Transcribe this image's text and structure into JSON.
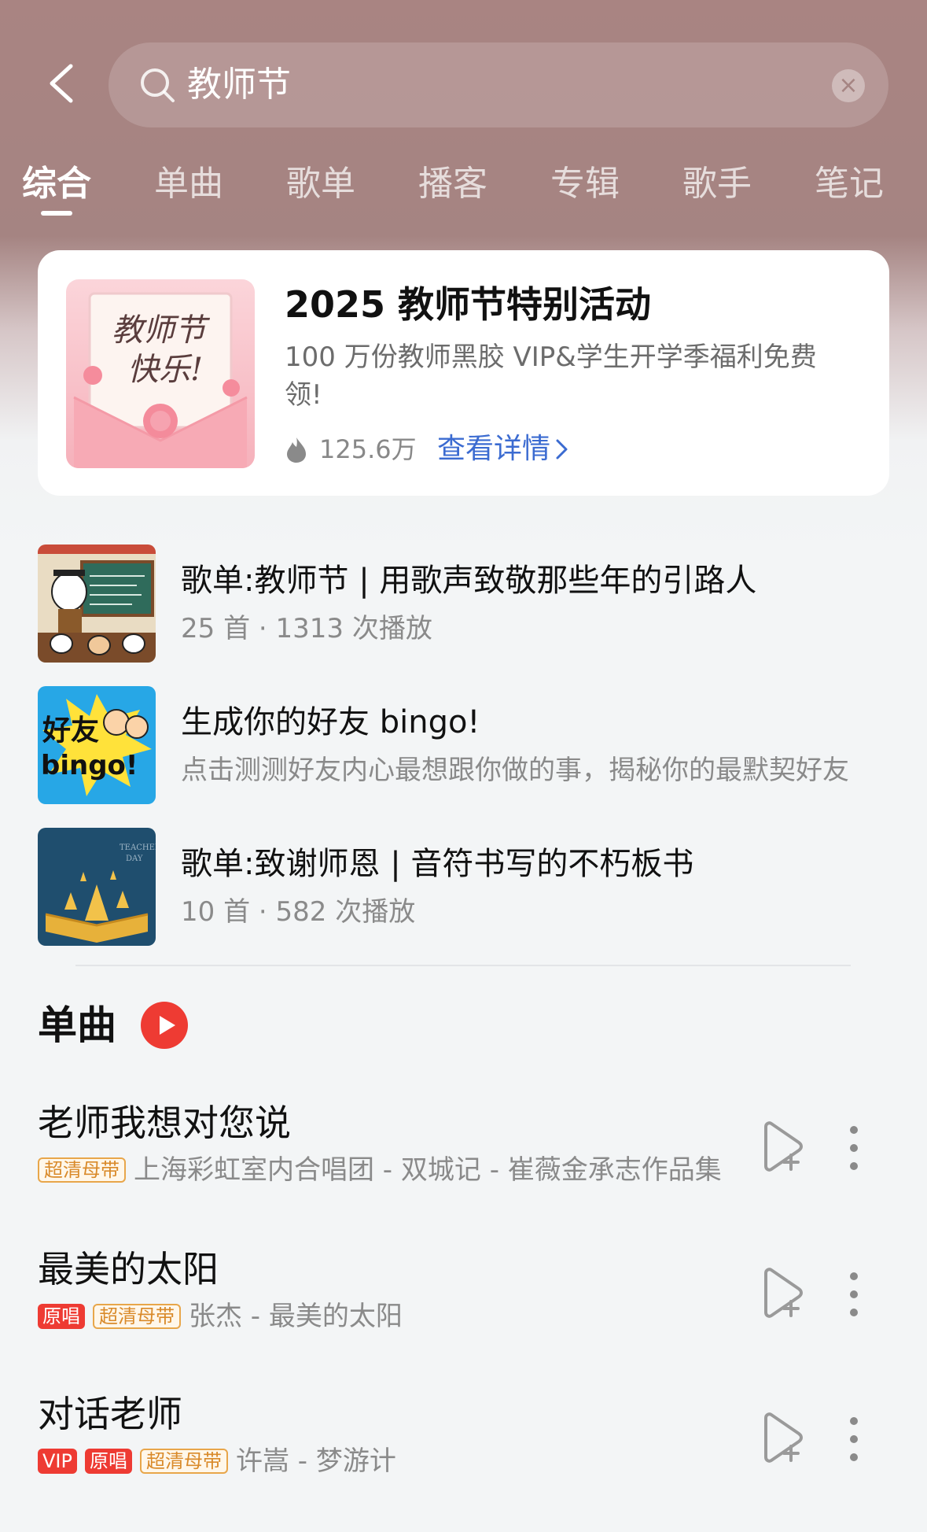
{
  "search": {
    "query": "教师节"
  },
  "tabs": [
    {
      "label": "综合"
    },
    {
      "label": "单曲"
    },
    {
      "label": "歌单"
    },
    {
      "label": "播客"
    },
    {
      "label": "专辑"
    },
    {
      "label": "歌手"
    },
    {
      "label": "笔记"
    }
  ],
  "activity": {
    "title": "2025 教师节特别活动",
    "description": "100 万份教师黑胶 VIP&学生开学季福利免费领!",
    "heat": "125.6万",
    "detail_label": "查看详情",
    "thumb_text_line1": "教师节",
    "thumb_text_line2": "快乐!"
  },
  "playlists": [
    {
      "title": "歌单:教师节 | 用歌声致敬那些年的引路人",
      "subtitle": "25 首 · 1313 次播放"
    },
    {
      "title": "生成你的好友 bingo!",
      "subtitle": "点击测测好友内心最想跟你做的事，揭秘你的最默契好友",
      "cover_text_line1": "好友",
      "cover_text_line2": "bingo!"
    },
    {
      "title": "歌单:致谢师恩 | 音符书写的不朽板书",
      "subtitle": "10 首 · 582 次播放",
      "cover_text_line1": "TEACHERS",
      "cover_text_line2": "DAY"
    }
  ],
  "songs_section": {
    "title": "单曲"
  },
  "songs": [
    {
      "title": "老师我想对您说",
      "badges": [
        "超清母带"
      ],
      "artist": "上海彩虹室内合唱团 - 双城记 - 崔薇金承志作品集"
    },
    {
      "title": "最美的太阳",
      "badges": [
        "原唱",
        "超清母带"
      ],
      "artist": "张杰 - 最美的太阳"
    },
    {
      "title": "对话老师",
      "badges": [
        "VIP",
        "原唱",
        "超清母带"
      ],
      "artist": "许嵩 - 梦游计"
    }
  ],
  "colors": {
    "header_bg": "#a58482",
    "link_blue": "#3b6bd1",
    "play_red": "#ee3b33",
    "badge_gold": "#e8a64a"
  }
}
